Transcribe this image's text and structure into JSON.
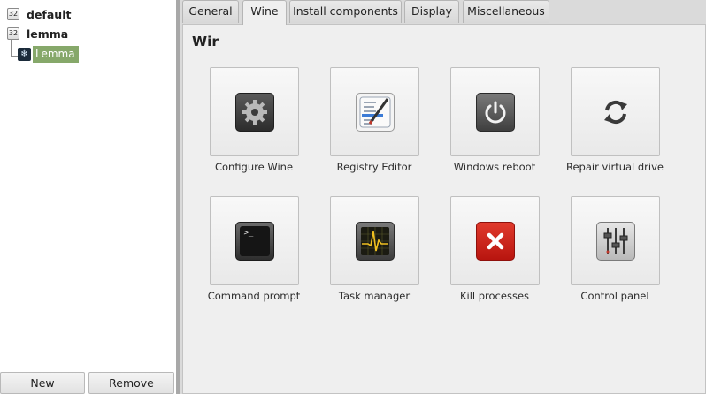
{
  "sidebar": {
    "items": [
      {
        "badge": "32",
        "label": "default"
      },
      {
        "badge": "32",
        "label": "lemma"
      }
    ],
    "child": {
      "label": "Lemma"
    },
    "buttons": {
      "new": "New",
      "remove": "Remove"
    }
  },
  "tabs": [
    {
      "label": "General",
      "active": false
    },
    {
      "label": "Wine",
      "active": true
    },
    {
      "label": "Install components",
      "active": false
    },
    {
      "label": "Display",
      "active": false
    },
    {
      "label": "Miscellaneous",
      "active": false
    }
  ],
  "panel": {
    "title": "Wir",
    "tools": [
      {
        "label": "Configure Wine",
        "icon": "gear-icon"
      },
      {
        "label": "Registry Editor",
        "icon": "registry-editor-icon"
      },
      {
        "label": "Windows reboot",
        "icon": "power-icon"
      },
      {
        "label": "Repair virtual drive",
        "icon": "refresh-icon"
      },
      {
        "label": "Command prompt",
        "icon": "terminal-icon"
      },
      {
        "label": "Task manager",
        "icon": "task-manager-icon"
      },
      {
        "label": "Kill processes",
        "icon": "close-icon"
      },
      {
        "label": "Control panel",
        "icon": "sliders-icon"
      }
    ]
  },
  "colors": {
    "selection": "#86a86a",
    "kill": "#d0201a",
    "panel_bg": "#efefef"
  }
}
